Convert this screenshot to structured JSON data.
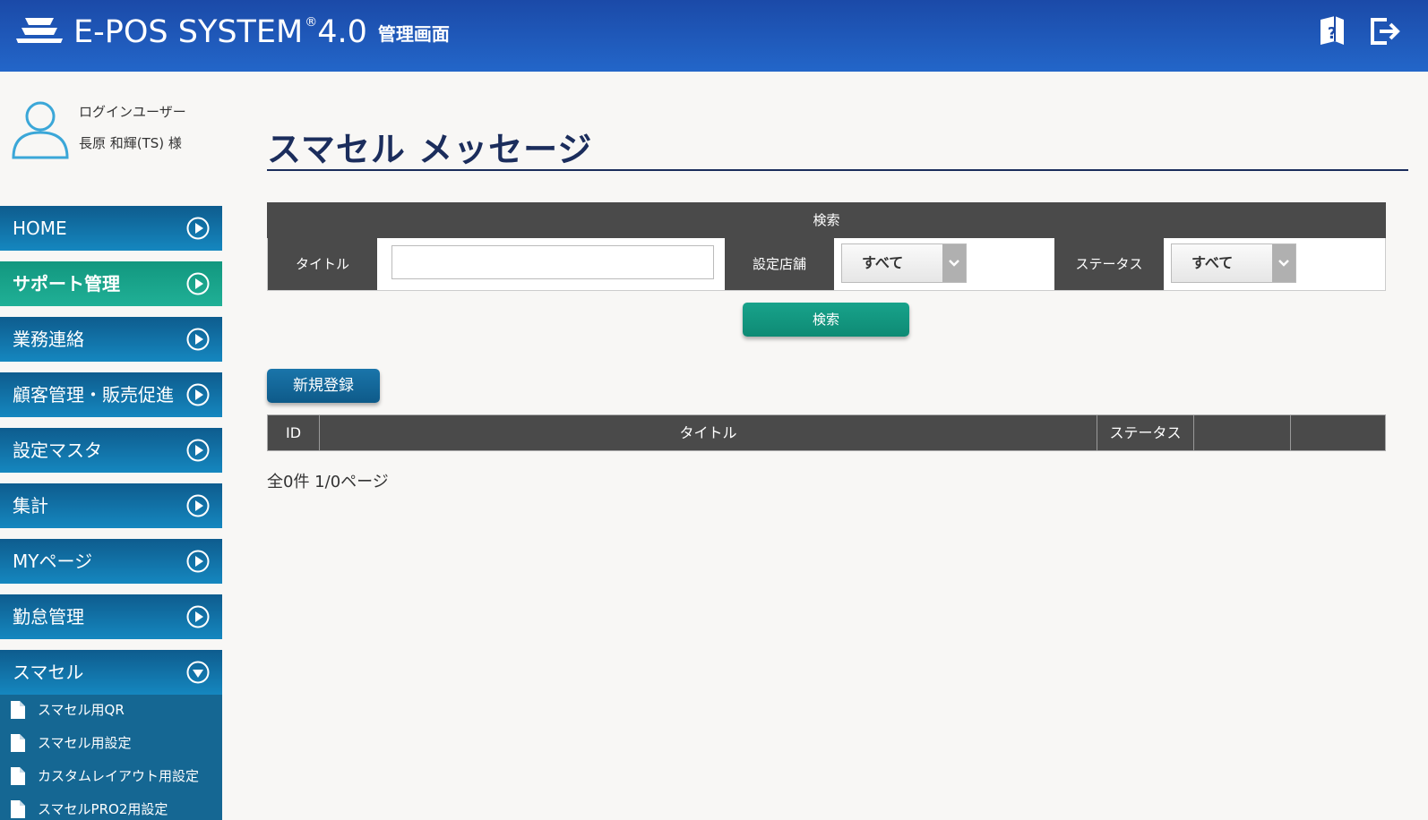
{
  "header": {
    "logo_text": "E-POS SYSTEM",
    "logo_reg": "®",
    "logo_version": "4.0",
    "logo_sub": "管理画面",
    "help_icon": "help-book-icon",
    "logout_icon": "logout-icon"
  },
  "user": {
    "label": "ログインユーザー",
    "name": "長原 和輝(TS) 様"
  },
  "nav": {
    "items": [
      {
        "label": "HOME"
      },
      {
        "label": "サポート管理"
      },
      {
        "label": "業務連絡"
      },
      {
        "label": "顧客管理・販売促進"
      },
      {
        "label": "設定マスタ"
      },
      {
        "label": "集計"
      },
      {
        "label": "MYページ"
      },
      {
        "label": "勤怠管理"
      },
      {
        "label": "スマセル"
      }
    ],
    "sub_items": [
      {
        "label": "スマセル用QR"
      },
      {
        "label": "スマセル用設定"
      },
      {
        "label": "カスタムレイアウト用設定"
      },
      {
        "label": "スマセルPRO2用設定"
      }
    ]
  },
  "main": {
    "title": "スマセル メッセージ",
    "search": {
      "header": "検索",
      "title_label": "タイトル",
      "title_value": "",
      "store_label": "設定店舗",
      "store_value": "すべて",
      "status_label": "ステータス",
      "status_value": "すべて",
      "button": "検索"
    },
    "new_button": "新規登録",
    "table": {
      "columns": [
        "ID",
        "タイトル",
        "ステータス",
        "",
        ""
      ]
    },
    "pager": "全0件 1/0ページ"
  },
  "colors": {
    "header_blue": "#1b4aa8",
    "nav_blue": "#1587bf",
    "nav_active_green": "#20b096",
    "title_navy": "#1b2d5c",
    "table_dark": "#4a4a4a"
  }
}
